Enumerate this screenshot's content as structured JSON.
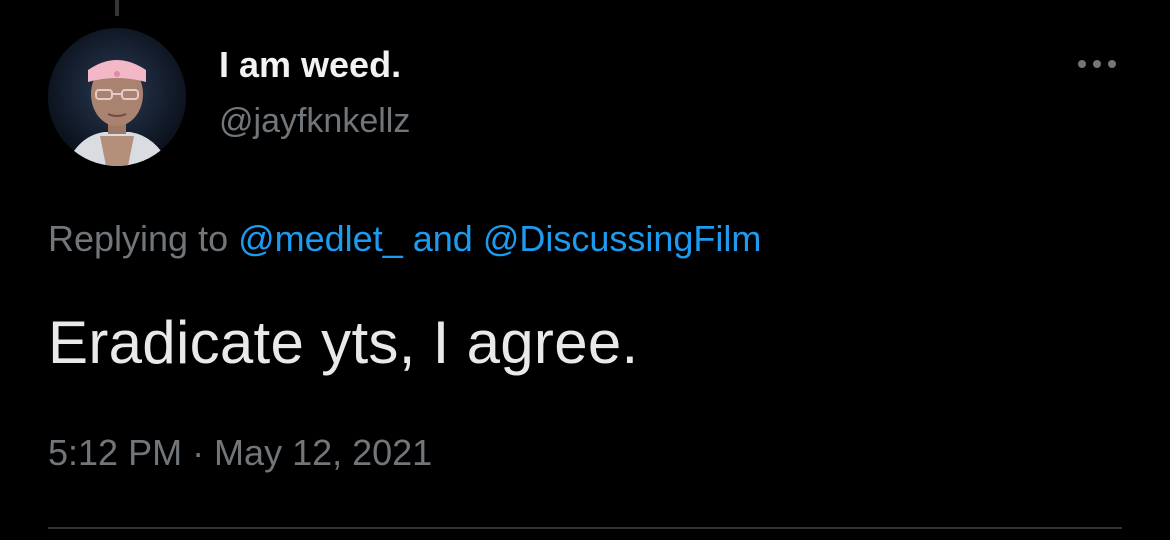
{
  "colors": {
    "background": "#000000",
    "text_primary": "#e7e9ea",
    "text_secondary": "#71767b",
    "accent_link": "#1d9bf0",
    "divider": "#2f3336"
  },
  "tweet": {
    "author": {
      "display_name": "I am weed.",
      "handle": "@jayfknkellz",
      "avatar_icon": "profile-photo"
    },
    "more_icon": "more-horizontal-icon",
    "reply_context": {
      "prefix": "Replying to ",
      "mention_1": "@medlet_",
      "joiner": " and ",
      "mention_2": "@DiscussingFilm"
    },
    "text": "Eradicate yts, I agree.",
    "timestamp": "5:12 PM · May 12, 2021"
  }
}
